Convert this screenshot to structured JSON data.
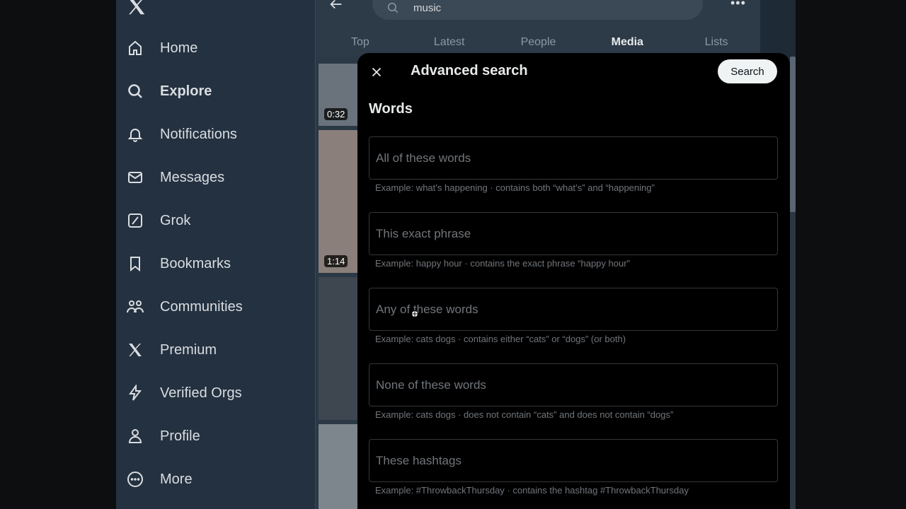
{
  "sidebar": {
    "items": [
      {
        "label": "Home",
        "icon": "home-icon"
      },
      {
        "label": "Explore",
        "icon": "search-icon",
        "active": true
      },
      {
        "label": "Notifications",
        "icon": "bell-icon"
      },
      {
        "label": "Messages",
        "icon": "mail-icon"
      },
      {
        "label": "Grok",
        "icon": "grok-icon"
      },
      {
        "label": "Bookmarks",
        "icon": "bookmark-icon"
      },
      {
        "label": "Communities",
        "icon": "people-icon"
      },
      {
        "label": "Premium",
        "icon": "x-logo-icon"
      },
      {
        "label": "Verified Orgs",
        "icon": "lightning-icon"
      },
      {
        "label": "Profile",
        "icon": "person-icon"
      },
      {
        "label": "More",
        "icon": "more-circle-icon"
      }
    ]
  },
  "header": {
    "search_value": "music",
    "tabs": [
      "Top",
      "Latest",
      "People",
      "Media",
      "Lists"
    ],
    "active_tab": "Media"
  },
  "media": {
    "durations": [
      "0:32",
      "1:14"
    ]
  },
  "modal": {
    "title": "Advanced search",
    "search_button": "Search",
    "section": "Words",
    "fields": [
      {
        "placeholder": "All of these words",
        "hint": "Example: what’s happening · contains both “what’s” and “happening”"
      },
      {
        "placeholder": "This exact phrase",
        "hint": "Example: happy hour · contains the exact phrase “happy hour”"
      },
      {
        "placeholder": "Any of these words",
        "hint": "Example: cats dogs · contains either “cats” or “dogs” (or both)"
      },
      {
        "placeholder": "None of these words",
        "hint": "Example: cats dogs · does not contain “cats” and does not contain “dogs”"
      },
      {
        "placeholder": "These hashtags",
        "hint": "Example: #ThrowbackThursday · contains the hashtag #ThrowbackThursday"
      }
    ]
  },
  "colors": {
    "background": "#15202b",
    "sidebar": "#243140",
    "modal": "#000000",
    "muted_text": "#71767b",
    "button_bg": "#eff3f4"
  }
}
